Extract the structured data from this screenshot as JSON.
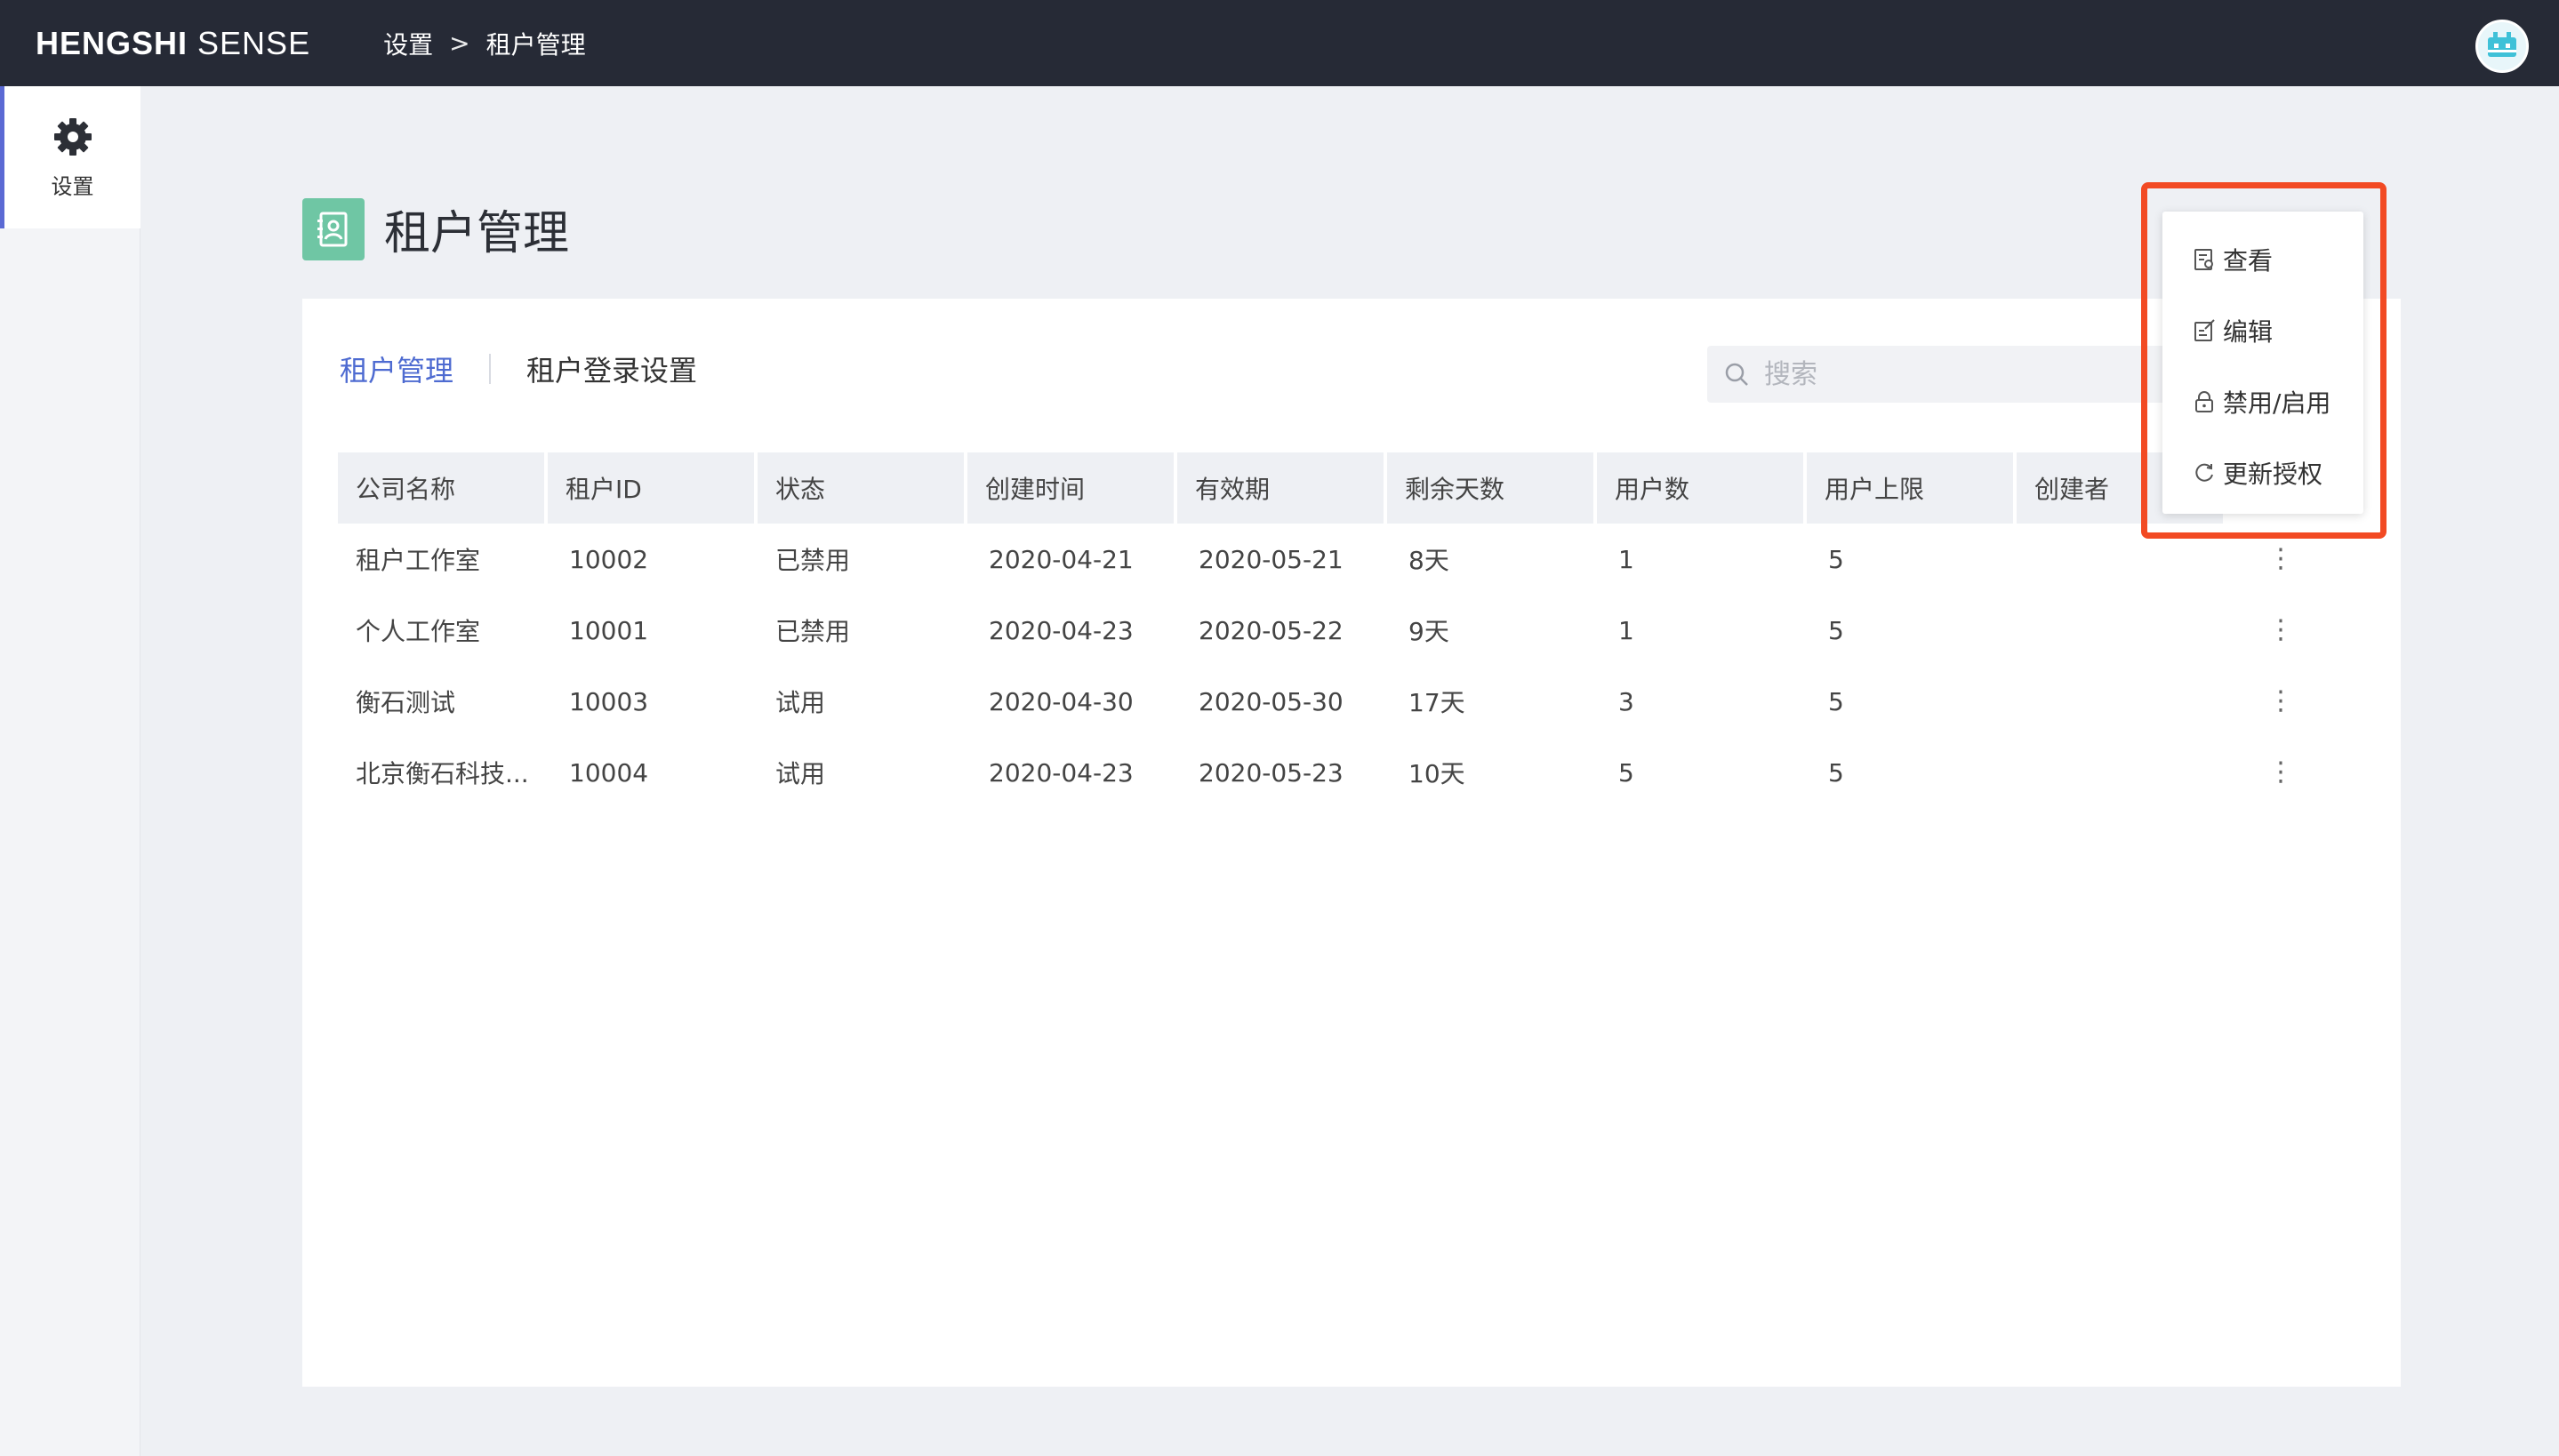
{
  "header": {
    "brand_bold": "HENGSHI",
    "brand_light": " SENSE",
    "breadcrumb": [
      "设置",
      ">",
      "租户管理"
    ]
  },
  "sidebar": {
    "items": [
      {
        "label": "设置",
        "icon": "gear-icon",
        "active": true
      }
    ]
  },
  "page": {
    "title": "租户管理",
    "icon": "tenant-card-icon",
    "accent": "#6fc6a4"
  },
  "tabs": [
    {
      "label": "租户管理",
      "active": true
    },
    {
      "label": "租户登录设置",
      "active": false
    }
  ],
  "search": {
    "placeholder": "搜索",
    "value": ""
  },
  "table": {
    "columns": [
      "公司名称",
      "租户ID",
      "状态",
      "创建时间",
      "有效期",
      "剩余天数",
      "用户数",
      "用户上限",
      "创建者"
    ],
    "rows": [
      [
        "租户工作室",
        "10002",
        "已禁用",
        "2020-04-21",
        "2020-05-21",
        "8天",
        "1",
        "5",
        ""
      ],
      [
        "个人工作室",
        "10001",
        "已禁用",
        "2020-04-23",
        "2020-05-22",
        "9天",
        "1",
        "5",
        ""
      ],
      [
        "衡石测试",
        "10003",
        "试用",
        "2020-04-30",
        "2020-05-30",
        "17天",
        "3",
        "5",
        ""
      ],
      [
        "北京衡石科技...",
        "10004",
        "试用",
        "2020-04-23",
        "2020-05-23",
        "10天",
        "5",
        "5",
        ""
      ]
    ],
    "row_action_glyph": "⋮"
  },
  "context_menu": {
    "items": [
      {
        "label": "查看",
        "icon": "view-doc-icon"
      },
      {
        "label": "编辑",
        "icon": "edit-icon"
      },
      {
        "label": "禁用/启用",
        "icon": "lock-icon"
      },
      {
        "label": "更新授权",
        "icon": "refresh-icon"
      }
    ],
    "highlight_color": "#f24a23"
  },
  "colors": {
    "topbar": "#262a36",
    "link": "#4e6bd1",
    "rail_accent": "#5b6ad4"
  }
}
